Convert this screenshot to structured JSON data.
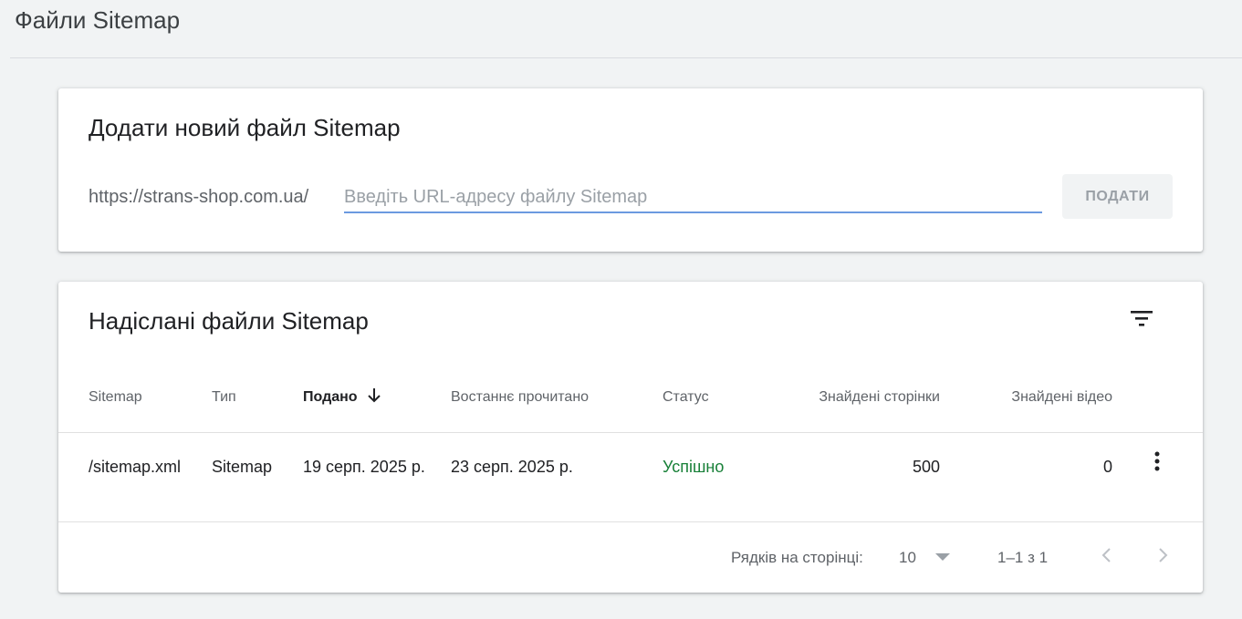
{
  "header": {
    "title": "Файли Sitemap"
  },
  "add_card": {
    "title": "Додати новий файл Sitemap",
    "url_prefix": "https://strans-shop.com.ua/",
    "input_value": "",
    "input_placeholder": "Введіть URL-адресу файлу Sitemap",
    "submit_label": "ПОДАТИ"
  },
  "list_card": {
    "title": "Надіслані файли Sitemap",
    "filter_icon": "filter-list-icon",
    "columns": [
      {
        "label": "Sitemap"
      },
      {
        "label": "Тип"
      },
      {
        "label": "Подано",
        "sorted": "desc"
      },
      {
        "label": "Востаннє прочитано"
      },
      {
        "label": "Статус"
      },
      {
        "label": "Знайдені сторінки"
      },
      {
        "label": "Знайдені відео"
      }
    ],
    "rows": [
      {
        "sitemap": "/sitemap.xml",
        "type": "Sitemap",
        "submitted": "19 серп. 2025 р.",
        "last_read": "23 серп. 2025 р.",
        "status": "Успішно",
        "pages_found": "500",
        "videos_found": "0"
      }
    ],
    "footer": {
      "rows_per_page_label": "Рядків на сторінці:",
      "rows_per_page_value": "10",
      "range": "1–1 з 1"
    }
  },
  "colors": {
    "accent": "#1a73e8",
    "status_success": "#188038",
    "background": "#f1f3f4"
  }
}
